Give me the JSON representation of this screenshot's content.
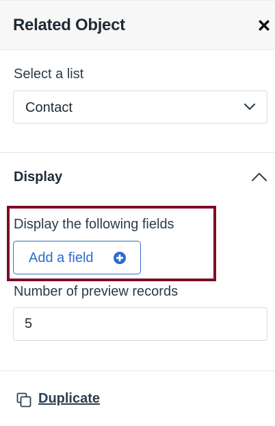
{
  "header": {
    "title": "Related Object",
    "close_icon": "close-icon"
  },
  "list_select": {
    "label": "Select a list",
    "value": "Contact",
    "icon": "chevron-down-icon"
  },
  "display_section": {
    "title": "Display",
    "toggle_icon": "chevron-up-icon",
    "fields_label": "Display the following fields",
    "add_field_label": "Add a field",
    "add_field_icon": "plus-circle-icon",
    "preview_label": "Number of preview records",
    "preview_value": "5"
  },
  "footer": {
    "duplicate_label": "Duplicate",
    "duplicate_icon": "copy-icon"
  },
  "colors": {
    "accent": "#2c6bcf",
    "highlight": "#7a0e25",
    "text": "#2d3e50",
    "header_bg": "#f7f7f7"
  }
}
